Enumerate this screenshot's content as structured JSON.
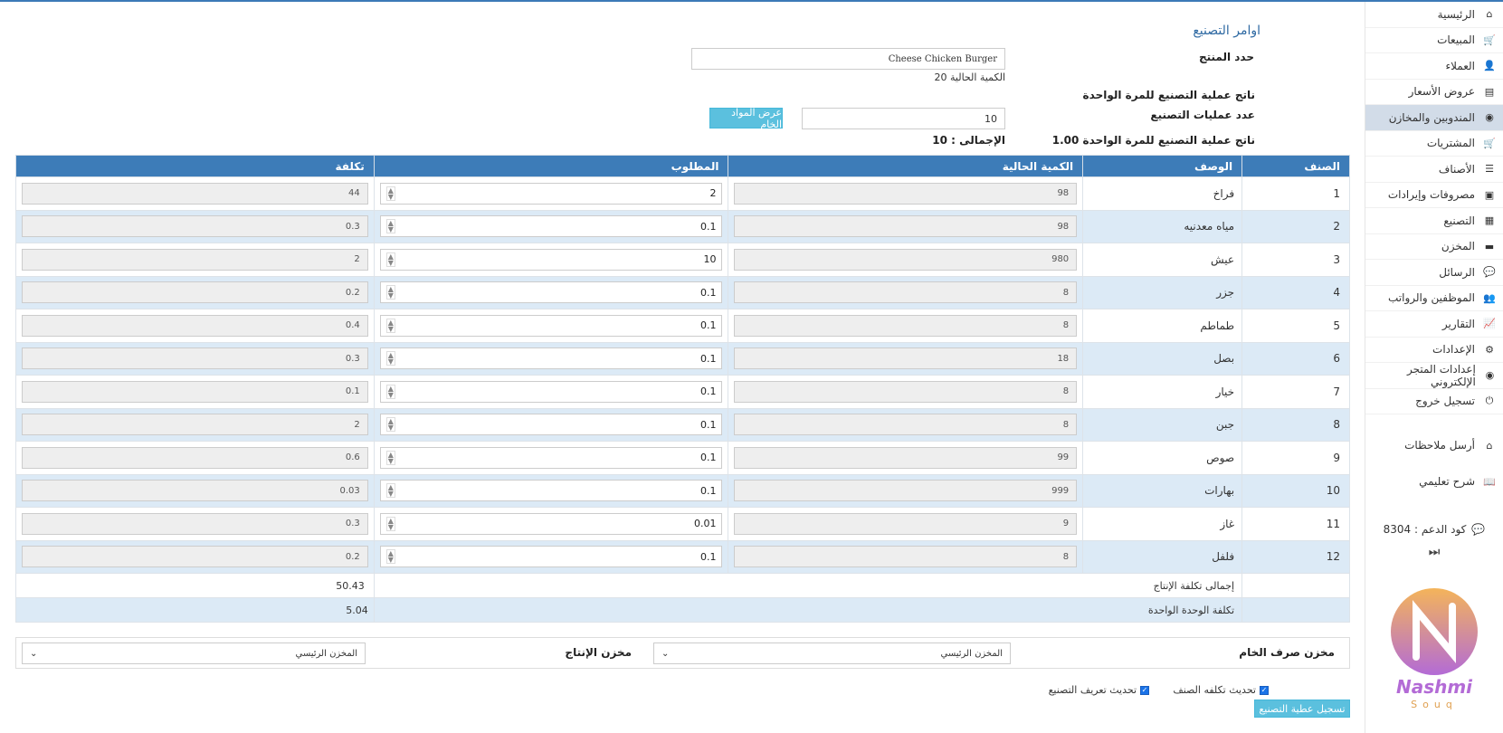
{
  "sidebar": {
    "items": [
      {
        "label": "الرئيسية",
        "icon": "home-icon",
        "glyph": "⌂"
      },
      {
        "label": "المبيعات",
        "icon": "cart-icon",
        "glyph": "🛒"
      },
      {
        "label": "العملاء",
        "icon": "user-icon",
        "glyph": "👤"
      },
      {
        "label": "عروض الأسعار",
        "icon": "list-alt-icon",
        "glyph": "▤"
      },
      {
        "label": "المندوبين والمخازن",
        "icon": "globe-icon",
        "glyph": "◉",
        "active": true
      },
      {
        "label": "المشتريات",
        "icon": "cart-plus-icon",
        "glyph": "🛒"
      },
      {
        "label": "الأصناف",
        "icon": "list-icon",
        "glyph": "☰"
      },
      {
        "label": "مصروفات وإيرادات",
        "icon": "money-icon",
        "glyph": "▣"
      },
      {
        "label": "التصنيع",
        "icon": "factory-icon",
        "glyph": "▦"
      },
      {
        "label": "المخزن",
        "icon": "truck-icon",
        "glyph": "▬"
      },
      {
        "label": "الرسائل",
        "icon": "comments-icon",
        "glyph": "💬"
      },
      {
        "label": "الموظفين والرواتب",
        "icon": "users-icon",
        "glyph": "👥"
      },
      {
        "label": "التقارير",
        "icon": "chart-icon",
        "glyph": "📈"
      },
      {
        "label": "الإعدادات",
        "icon": "cogs-icon",
        "glyph": "⚙"
      },
      {
        "label": "إعدادات المتجر الإلكتروني",
        "icon": "globe-icon",
        "glyph": "◉"
      },
      {
        "label": "تسجيل خروج",
        "icon": "power-icon",
        "glyph": "⏻"
      }
    ],
    "extra": [
      {
        "label": "أرسل ملاحظات",
        "icon": "home-icon",
        "glyph": "⌂"
      },
      {
        "label": "شرح تعليمي",
        "icon": "book-icon",
        "glyph": "📖"
      }
    ],
    "support": "كود الدعم : 8304",
    "ffw": "⏭",
    "logo_text": "Nashmi",
    "logo_sub": "Souq"
  },
  "form": {
    "title": "اوامر التصنيع",
    "product_label": "حدد المنتج",
    "product_value": "Cheese Chicken Burger",
    "current_qty": "الكمية الحالية 20",
    "yield_label": "ناتج عملية التصنيع للمرة الواحدة",
    "ops_label": "عدد عمليات التصنيع",
    "ops_value": "10",
    "show_raw_btn": "عرض المواد الخام",
    "yield_value": "ناتج عملية التصنيع للمرة الواحدة 1.00",
    "total": "الإجمالى : 10"
  },
  "table": {
    "headers": [
      "الصنف",
      "الوصف",
      "الكمية الحالية",
      "المطلوب",
      "تكلفة"
    ],
    "rows": [
      {
        "id": "1",
        "desc": "فراخ",
        "qty": "98",
        "req": "2",
        "cost": "44"
      },
      {
        "id": "2",
        "desc": "مياه معدنيه",
        "qty": "98",
        "req": "0.1",
        "cost": "0.3"
      },
      {
        "id": "3",
        "desc": "عيش",
        "qty": "980",
        "req": "10",
        "cost": "2"
      },
      {
        "id": "4",
        "desc": "جزر",
        "qty": "8",
        "req": "0.1",
        "cost": "0.2"
      },
      {
        "id": "5",
        "desc": "طماطم",
        "qty": "8",
        "req": "0.1",
        "cost": "0.4"
      },
      {
        "id": "6",
        "desc": "بصل",
        "qty": "18",
        "req": "0.1",
        "cost": "0.3"
      },
      {
        "id": "7",
        "desc": "خيار",
        "qty": "8",
        "req": "0.1",
        "cost": "0.1"
      },
      {
        "id": "8",
        "desc": "جبن",
        "qty": "8",
        "req": "0.1",
        "cost": "2"
      },
      {
        "id": "9",
        "desc": "صوص",
        "qty": "99",
        "req": "0.1",
        "cost": "0.6"
      },
      {
        "id": "10",
        "desc": "بهارات",
        "qty": "999",
        "req": "0.1",
        "cost": "0.03"
      },
      {
        "id": "11",
        "desc": "غاز",
        "qty": "9",
        "req": "0.01",
        "cost": "0.3"
      },
      {
        "id": "12",
        "desc": "فلفل",
        "qty": "8",
        "req": "0.1",
        "cost": "0.2"
      }
    ],
    "total_label": "إجمالى تكلفة الإنتاج",
    "total_value": "50.43",
    "unit_label": "تكلفة الوحدة الواحدة",
    "unit_value": "5.04"
  },
  "stores": {
    "raw_label": "مخزن صرف الخام",
    "raw_value": "المخزن الرئيسي",
    "prod_label": "مخزن الإنتاج",
    "prod_value": "المخزن الرئيسي"
  },
  "footer": {
    "update_cost": "تحديث تكلفه الصنف",
    "update_def": "تحديث تعريف التصنيع",
    "submit": "تسجيل عطية التصنيع"
  }
}
